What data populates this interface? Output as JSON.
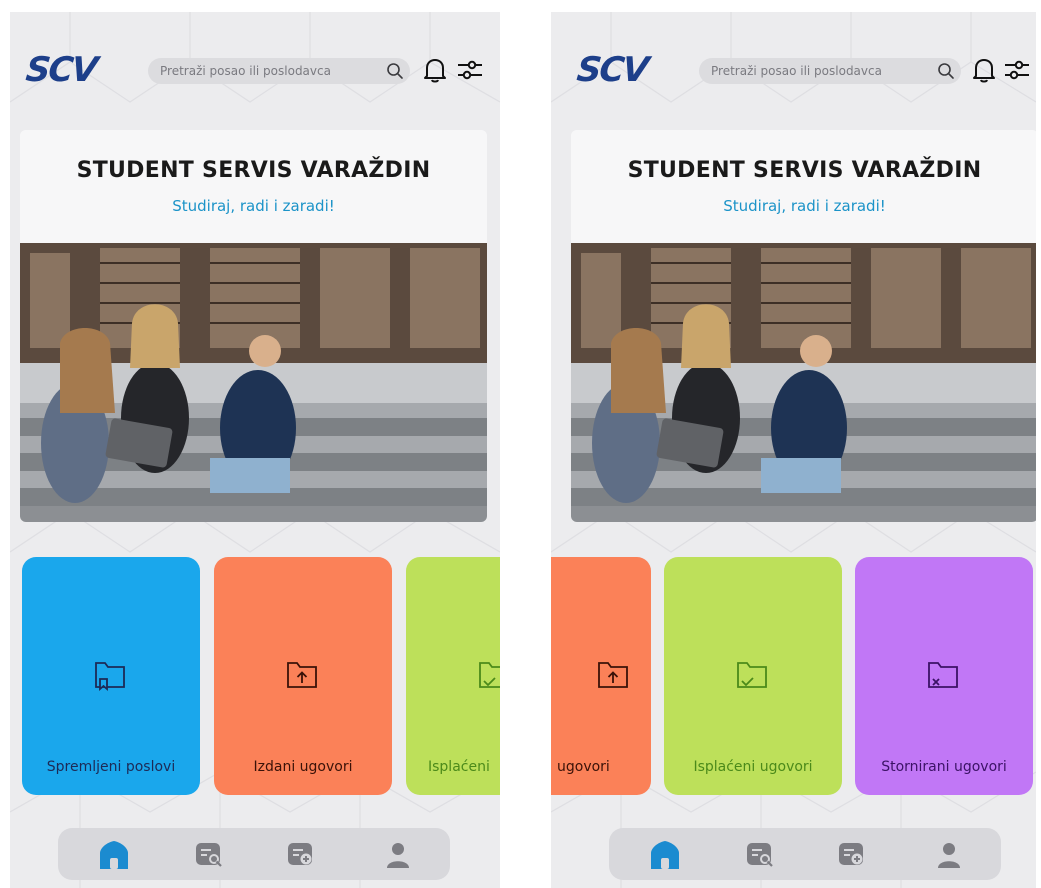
{
  "brand": {
    "logo": "SCV"
  },
  "search": {
    "placeholder": "Pretraži posao ili poslodavca"
  },
  "hero": {
    "title": "STUDENT SERVIS VARAŽDIN",
    "subtitle": "Studiraj, radi i zaradi!"
  },
  "screens": [
    {
      "cards": [
        {
          "label": "Spremljeni poslovi",
          "color": "#1aa7ec",
          "text_color": "#1d2a56",
          "icon": "folder-bookmark-icon"
        },
        {
          "label": "Izdani ugovori",
          "color": "#fb8158",
          "text_color": "#3a1208",
          "icon": "folder-upload-icon"
        },
        {
          "label": "Isplaćeni",
          "color": "#bde05a",
          "text_color": "#4b8a1a",
          "icon": "folder-check-icon"
        }
      ]
    },
    {
      "cards": [
        {
          "label": "ugovori",
          "color": "#fb8158",
          "text_color": "#3a1208",
          "icon": "folder-upload-icon"
        },
        {
          "label": "Isplaćeni ugovori",
          "color": "#bde05a",
          "text_color": "#4b8a1a",
          "icon": "folder-check-icon"
        },
        {
          "label": "Stornirani ugovori",
          "color": "#c177f6",
          "text_color": "#3b1265",
          "icon": "folder-x-icon"
        }
      ]
    }
  ],
  "nav": {
    "items": [
      "home-icon",
      "job-search-icon",
      "add-contract-icon",
      "profile-icon"
    ],
    "active": "home-icon",
    "active_color": "#1b8bd0",
    "inactive_color": "#7c7c82"
  }
}
